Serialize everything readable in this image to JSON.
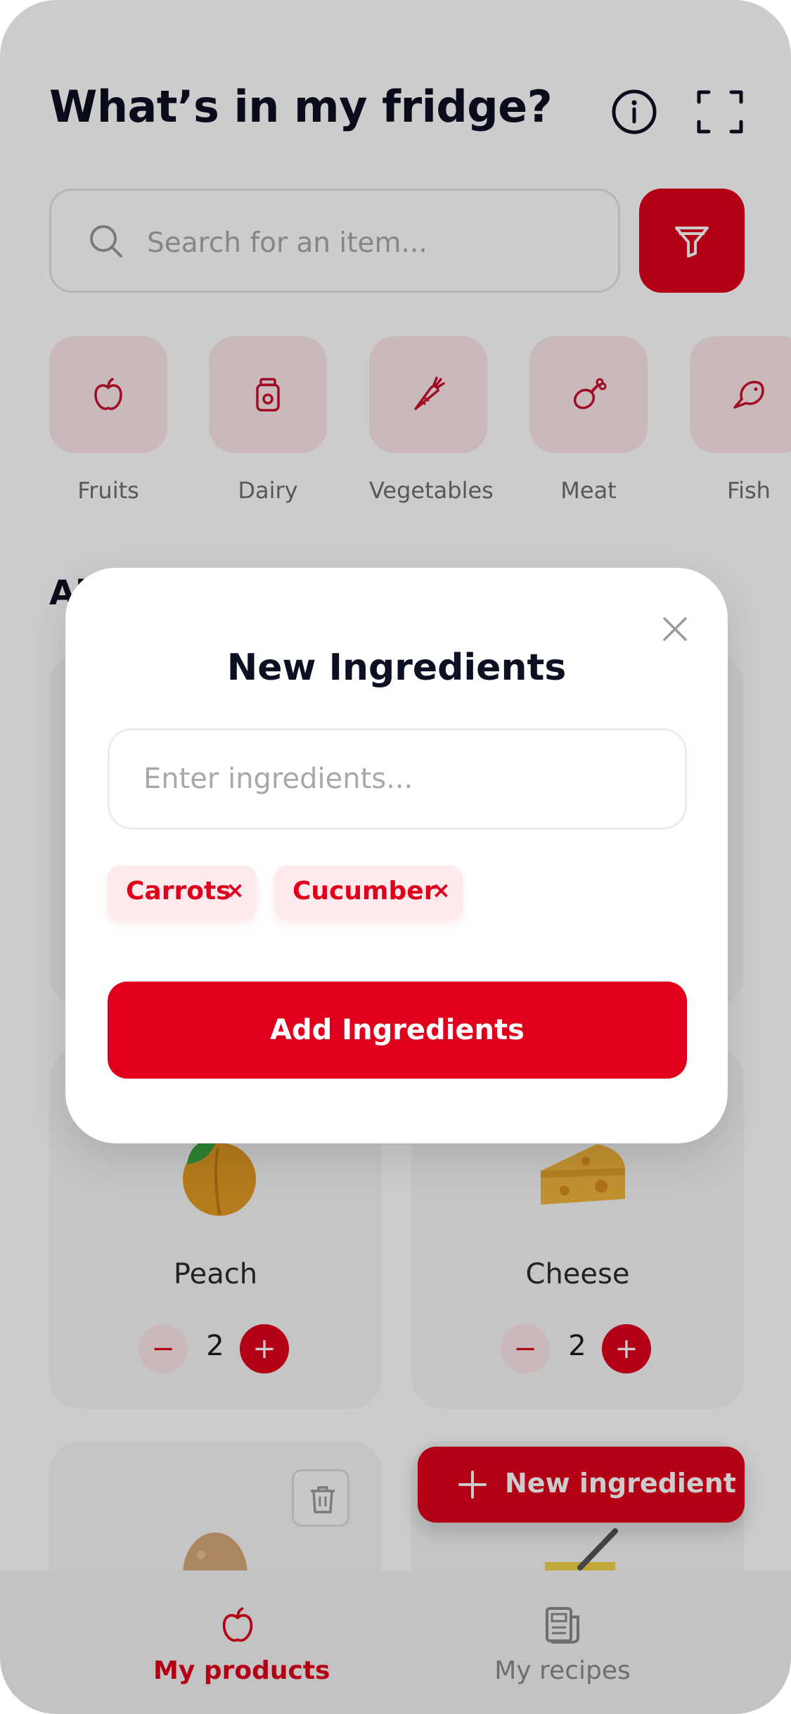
{
  "header": {
    "title": "What’s in my fridge?"
  },
  "search": {
    "placeholder": "Search for an item..."
  },
  "categories": [
    {
      "label": "Fruits",
      "icon": "apple-icon"
    },
    {
      "label": "Dairy",
      "icon": "jar-icon"
    },
    {
      "label": "Vegetables",
      "icon": "carrot-icon"
    },
    {
      "label": "Meat",
      "icon": "meat-icon"
    },
    {
      "label": "Fish",
      "icon": "fish-icon"
    }
  ],
  "section": {
    "title": "Al"
  },
  "products": [
    {
      "name": "Peach",
      "quantity": "2"
    },
    {
      "name": "Cheese",
      "quantity": "2"
    }
  ],
  "fab": {
    "label": "New ingredient"
  },
  "bottom_nav": {
    "items": [
      {
        "label": "My products",
        "active": true
      },
      {
        "label": "My recipes",
        "active": false
      }
    ]
  },
  "modal": {
    "title": "New Ingredients",
    "input_placeholder": "Enter ingredients...",
    "chips": [
      {
        "label": "Carrots",
        "remove": "×"
      },
      {
        "label": "Cucumber",
        "remove": "×"
      }
    ],
    "submit_label": "Add Ingredients"
  },
  "colors": {
    "accent": "#e0001b",
    "accent_light": "#fde8ea",
    "text": "#0d1022"
  }
}
